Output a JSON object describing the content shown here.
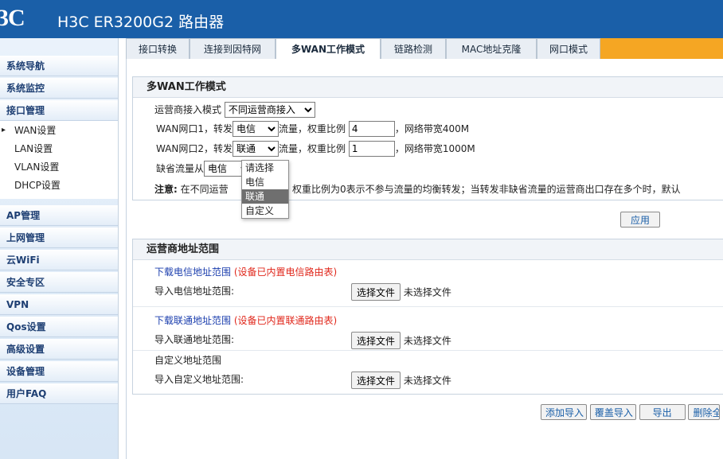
{
  "header": {
    "logo": "3C",
    "title": "H3C ER3200G2 路由器"
  },
  "sidebar": {
    "items": [
      {
        "label": "系统导航"
      },
      {
        "label": "系统监控"
      },
      {
        "label": "接口管理"
      },
      {
        "label": "AP管理"
      },
      {
        "label": "上网管理"
      },
      {
        "label": "云WiFi"
      },
      {
        "label": "安全专区"
      },
      {
        "label": "VPN"
      },
      {
        "label": "Qos设置"
      },
      {
        "label": "高级设置"
      },
      {
        "label": "设备管理"
      },
      {
        "label": "用户FAQ"
      }
    ],
    "subitems": [
      {
        "label": "WAN设置"
      },
      {
        "label": "LAN设置"
      },
      {
        "label": "VLAN设置"
      },
      {
        "label": "DHCP设置"
      }
    ]
  },
  "tabs": [
    {
      "label": "接口转换"
    },
    {
      "label": "连接到因特网"
    },
    {
      "label": "多WAN工作模式"
    },
    {
      "label": "链路检测"
    },
    {
      "label": "MAC地址克隆"
    },
    {
      "label": "网口模式"
    }
  ],
  "multiwan": {
    "title": "多WAN工作模式",
    "isp_mode_label": "运营商接入模式",
    "isp_mode_value": "不同运营商接入",
    "wan1_prefix": "WAN网口1，转发",
    "wan1_isp": "电信",
    "wan1_mid": "流量，权重比例",
    "wan1_weight": "4",
    "wan1_bandwidth": "，网络带宽400M",
    "wan2_prefix": "WAN网口2，转发",
    "wan2_isp": "联通",
    "wan2_mid": "流量，权重比例",
    "wan2_weight": "1",
    "wan2_bandwidth": "，网络带宽1000M",
    "default_label": "缺省流量从",
    "default_value": "电信",
    "note_label": "注意:",
    "note_text_a": "在不同运营",
    "note_text_b": "权重比例为0表示不参与流量的均衡转发；当转发非缺省流量的运营商出口存在多个时，默认",
    "apply_button": "应用"
  },
  "dropdown": {
    "options": [
      {
        "label": "请选择"
      },
      {
        "label": "电信"
      },
      {
        "label": "联通"
      },
      {
        "label": "自定义"
      }
    ],
    "highlighted": "联通"
  },
  "isp_range": {
    "title": "运营商地址范围",
    "telecom_download": "下载电信地址范围",
    "telecom_note": "(设备已内置电信路由表)",
    "telecom_import_label": "导入电信地址范围:",
    "unicom_download": "下载联通地址范围",
    "unicom_note": "(设备已内置联通路由表)",
    "unicom_import_label": "导入联通地址范围:",
    "custom_title": "自定义地址范围",
    "custom_import_label": "导入自定义地址范围:",
    "choose_file": "选择文件",
    "no_file": "未选择文件"
  },
  "bottom_buttons": {
    "add_import": "添加导入",
    "overwrite_import": "覆盖导入",
    "export": "导出",
    "delete_all": "删除全"
  }
}
